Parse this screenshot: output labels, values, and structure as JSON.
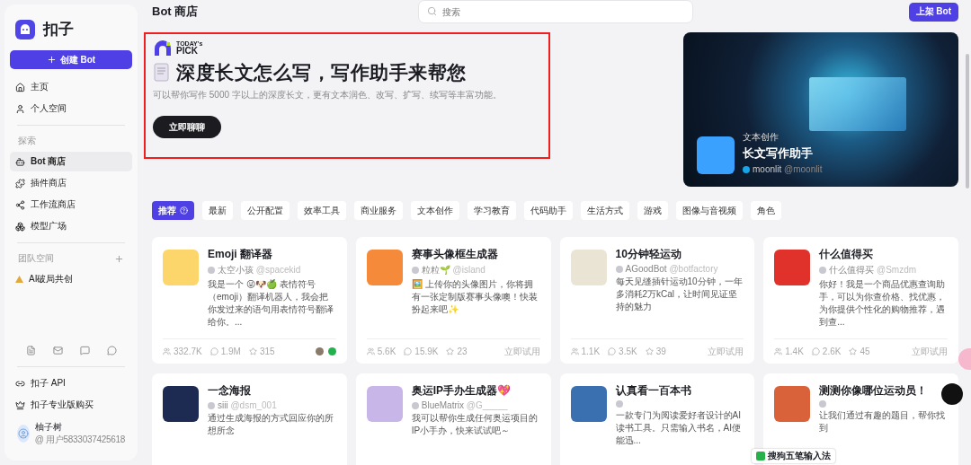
{
  "sidebar": {
    "logo_text": "扣子",
    "create_button": "创建 Bot",
    "main_items": [
      {
        "label": "主页",
        "selected": false
      },
      {
        "label": "个人空间",
        "selected": false
      }
    ],
    "explore_heading": "探索",
    "explore_items": [
      {
        "label": "Bot 商店",
        "selected": true
      },
      {
        "label": "插件商店",
        "selected": false
      },
      {
        "label": "工作流商店",
        "selected": false
      },
      {
        "label": "模型广场",
        "selected": false
      }
    ],
    "team_heading": "团队空间",
    "team_items": [
      {
        "label": "AI破局共创",
        "selected": false
      }
    ],
    "bottom_links": [
      "扣子 API",
      "扣子专业版购买"
    ],
    "user": {
      "name": "柚子树",
      "id": "@ 用户5833037425618"
    }
  },
  "header": {
    "title": "Bot 商店",
    "search": {
      "placeholder": "搜索"
    },
    "publish_button": "上架 Bot"
  },
  "hero": {
    "badge_small": "TODAY's",
    "badge_big": "PICK",
    "headline": "深度长文怎么写，写作助手来帮您",
    "description": "可以帮你写作 5000 字以上的深度长文，更有文本润色、改写、扩写、续写等丰富功能。",
    "button": "立即聊聊",
    "featured": {
      "category": "文本创作",
      "name": "长文写作助手",
      "author": "moonlit",
      "handle": "@moonlit"
    }
  },
  "tabs": [
    {
      "label": "推荐",
      "selected": true
    },
    {
      "label": "最新",
      "selected": false
    },
    {
      "label": "公开配置",
      "selected": false
    },
    {
      "label": "效率工具",
      "selected": false
    },
    {
      "label": "商业服务",
      "selected": false
    },
    {
      "label": "文本创作",
      "selected": false
    },
    {
      "label": "学习教育",
      "selected": false
    },
    {
      "label": "代码助手",
      "selected": false
    },
    {
      "label": "生活方式",
      "selected": false
    },
    {
      "label": "游戏",
      "selected": false
    },
    {
      "label": "图像与音视频",
      "selected": false
    },
    {
      "label": "角色",
      "selected": false
    }
  ],
  "cards": [
    {
      "title": "Emoji 翻译器",
      "author": "太空小孩",
      "handle": "@spacekid",
      "description": "我是一个 😜🐶🍏 表情符号（emoji）翻译机器人，我会把你发过来的语句用表情符号翻译给你。...",
      "users": "332.7K",
      "chats": "1.9M",
      "favorites": "315",
      "color": "#fcd66a"
    },
    {
      "title": "赛事头像框生成器",
      "author": "粒粒🌱",
      "handle": "@island",
      "description": "🖼️ 上传你的头像图片，你将拥有一张定制版赛事头像噢！快装扮起来吧✨",
      "users": "5.6K",
      "chats": "15.9K",
      "favorites": "23",
      "action": "立即试用",
      "color": "#f58a3a"
    },
    {
      "title": "10分钟轻运动",
      "author": "AGoodBot",
      "handle": "@botfactory",
      "description": "每天见缝插针运动10分钟，一年多消耗2万kCal，让时间见证坚持的魅力",
      "users": "1.1K",
      "chats": "3.5K",
      "favorites": "39",
      "action": "立即试用",
      "color": "#e9e4d3"
    },
    {
      "title": "什么值得买",
      "author": "什么值得买",
      "handle": "@Smzdm",
      "description": "你好！我是一个商品优惠查询助手，可以为你查价格、找优惠，为你提供个性化的购物推荐，遇到查...",
      "users": "1.4K",
      "chats": "2.6K",
      "favorites": "45",
      "action": "立即试用",
      "color": "#e0322b"
    },
    {
      "title": "一念海报",
      "author": "siii",
      "handle": "@dsm_001",
      "description": "通过生成海报的方式回应你的所想所念",
      "color": "#1d2a52"
    },
    {
      "title": "奥运IP手办生成器💖",
      "author": "BlueMatrix",
      "handle": "@G_____",
      "description": "我可以帮你生成任何奥运项目的IP小手办，快来试试吧～",
      "color": "#c9b6e8"
    },
    {
      "title": "认真看一百本书",
      "description": "一款专门为阅读爱好者设计的AI读书工具。只需输入书名，AI便能迅...",
      "color": "#3a6fb0"
    },
    {
      "title": "测测你像哪位运动员！",
      "description": "让我们通过有趣的题目，帮你找到",
      "color": "#d9623a"
    }
  ],
  "ime_bar": {
    "label": "搜狗五笔输入法"
  }
}
